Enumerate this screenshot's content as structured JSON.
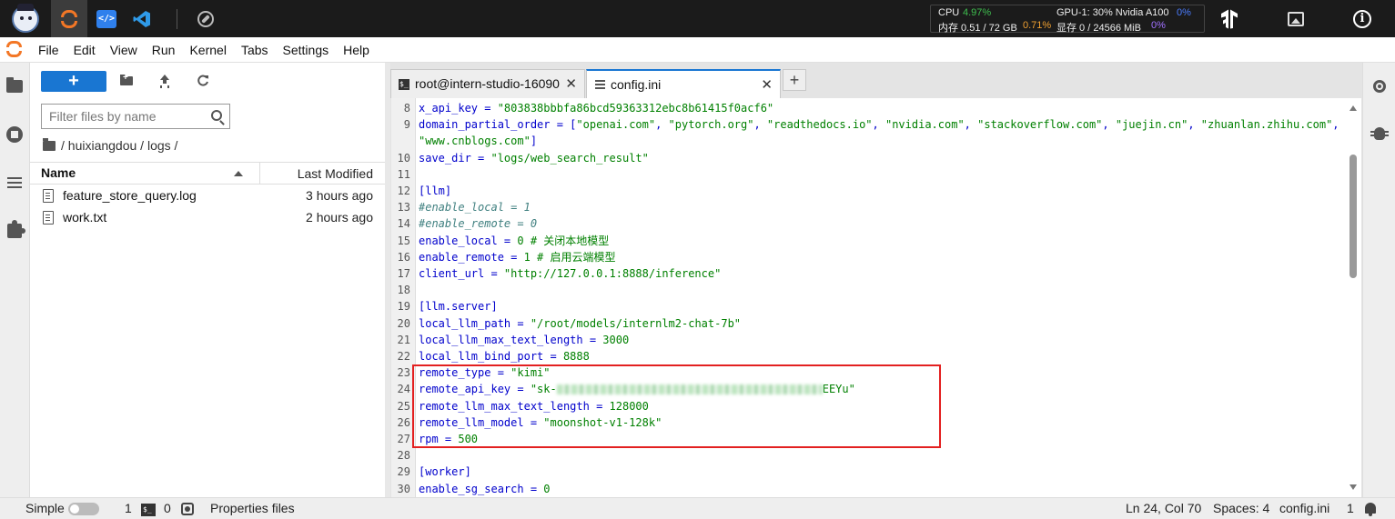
{
  "topbar": {
    "resources": {
      "cpu_label": "CPU",
      "cpu_value": "4.97%",
      "mem_label": "内存 0.51 / 72 GB",
      "mem_value": "0.71%",
      "gpu_label": "GPU-1: 30% Nvidia A100",
      "gpu_value": "0%",
      "vram_label": "显存 0 / 24566 MiB",
      "vram_value": "0%"
    },
    "icons": [
      "avatar-icon",
      "jupyter-icon",
      "code-server-icon",
      "vscode-icon",
      "compass-icon",
      "tensorflow-icon",
      "image-icon",
      "info-icon"
    ]
  },
  "menubar": {
    "items": [
      "File",
      "Edit",
      "View",
      "Run",
      "Kernel",
      "Tabs",
      "Settings",
      "Help"
    ]
  },
  "filebrowser": {
    "new_label": "+",
    "search_placeholder": "Filter files by name",
    "breadcrumb": "/ huixiangdou / logs /",
    "col_name": "Name",
    "col_modified": "Last Modified",
    "files": [
      {
        "name": "feature_store_query.log",
        "modified": "3 hours ago"
      },
      {
        "name": "work.txt",
        "modified": "2 hours ago"
      }
    ]
  },
  "tabs": [
    {
      "label": "root@intern-studio-16090",
      "close": "✕"
    },
    {
      "label": "config.ini",
      "close": "✕"
    }
  ],
  "add_tab_label": "+",
  "editor": {
    "lines": [
      {
        "n": "8",
        "parts": [
          [
            "k",
            "x_api_key = "
          ],
          [
            "s",
            "\"803838bbbfa86bcd59363312ebc8b61415f0acf6\""
          ]
        ]
      },
      {
        "n": "9",
        "parts": [
          [
            "k",
            "domain_partial_order = ["
          ],
          [
            "s",
            "\"openai.com\""
          ],
          [
            "k",
            ", "
          ],
          [
            "s",
            "\"pytorch.org\""
          ],
          [
            "k",
            ", "
          ],
          [
            "s",
            "\"readthedocs.io\""
          ],
          [
            "k",
            ", "
          ],
          [
            "s",
            "\"nvidia.com\""
          ],
          [
            "k",
            ", "
          ],
          [
            "s",
            "\"stackoverflow.com\""
          ],
          [
            "k",
            ", "
          ],
          [
            "s",
            "\"juejin.cn\""
          ],
          [
            "k",
            ", "
          ],
          [
            "s",
            "\"zhuanlan.zhihu.com\""
          ],
          [
            "k",
            ","
          ]
        ]
      },
      {
        "n": "",
        "parts": [
          [
            "s",
            "\"www.cnblogs.com\""
          ],
          [
            "k",
            "]"
          ]
        ]
      },
      {
        "n": "10",
        "parts": [
          [
            "k",
            "save_dir = "
          ],
          [
            "s",
            "\"logs/web_search_result\""
          ]
        ]
      },
      {
        "n": "11",
        "parts": []
      },
      {
        "n": "12",
        "parts": [
          [
            "h",
            "[llm]"
          ]
        ]
      },
      {
        "n": "13",
        "parts": [
          [
            "cm",
            "#enable_local = 1"
          ]
        ]
      },
      {
        "n": "14",
        "parts": [
          [
            "cm",
            "#enable_remote = 0"
          ]
        ]
      },
      {
        "n": "15",
        "parts": [
          [
            "k",
            "enable_local = "
          ],
          [
            "n",
            "0"
          ],
          [
            "c",
            " # 关闭本地模型"
          ]
        ]
      },
      {
        "n": "16",
        "parts": [
          [
            "k",
            "enable_remote = "
          ],
          [
            "n",
            "1"
          ],
          [
            "c",
            " # 启用云端模型"
          ]
        ]
      },
      {
        "n": "17",
        "parts": [
          [
            "k",
            "client_url = "
          ],
          [
            "s",
            "\"http://127.0.0.1:8888/inference\""
          ]
        ]
      },
      {
        "n": "18",
        "parts": []
      },
      {
        "n": "19",
        "parts": [
          [
            "h",
            "[llm.server]"
          ]
        ]
      },
      {
        "n": "20",
        "parts": [
          [
            "k",
            "local_llm_path = "
          ],
          [
            "s",
            "\"/root/models/internlm2-chat-7b\""
          ]
        ]
      },
      {
        "n": "21",
        "parts": [
          [
            "k",
            "local_llm_max_text_length = "
          ],
          [
            "n",
            "3000"
          ]
        ]
      },
      {
        "n": "22",
        "parts": [
          [
            "k",
            "local_llm_bind_port = "
          ],
          [
            "n",
            "8888"
          ]
        ]
      },
      {
        "n": "23",
        "parts": [
          [
            "k",
            "remote_type = "
          ],
          [
            "s",
            "\"kimi\""
          ]
        ]
      },
      {
        "n": "24",
        "parts": [
          [
            "k",
            "remote_api_key = "
          ],
          [
            "s",
            "\"sk-"
          ],
          [
            "blur",
            ""
          ],
          [
            "s",
            "EEYu\""
          ]
        ]
      },
      {
        "n": "25",
        "parts": [
          [
            "k",
            "remote_llm_max_text_length = "
          ],
          [
            "n",
            "128000"
          ]
        ]
      },
      {
        "n": "26",
        "parts": [
          [
            "k",
            "remote_llm_model = "
          ],
          [
            "s",
            "\"moonshot-v1-128k\""
          ]
        ]
      },
      {
        "n": "27",
        "parts": [
          [
            "k",
            "rpm = "
          ],
          [
            "n",
            "500"
          ]
        ]
      },
      {
        "n": "28",
        "parts": []
      },
      {
        "n": "29",
        "parts": [
          [
            "h",
            "[worker]"
          ]
        ]
      },
      {
        "n": "30",
        "parts": [
          [
            "k",
            "enable_sg_search = "
          ],
          [
            "n",
            "0"
          ]
        ]
      }
    ]
  },
  "statusbar": {
    "mode": "Simple",
    "terminals_count": "1",
    "kernels_count": "0",
    "file_type": "Properties files",
    "cursor": "Ln 24, Col 70",
    "spaces": "Spaces: 4",
    "filename": "config.ini",
    "notifications": "1"
  }
}
